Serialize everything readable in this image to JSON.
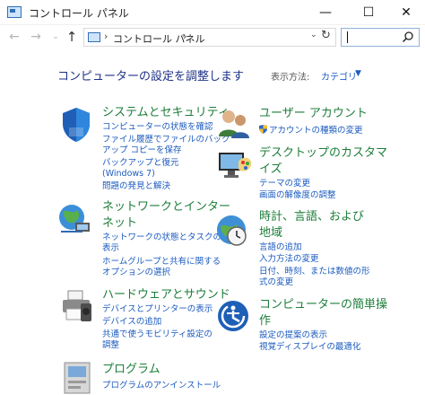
{
  "window": {
    "title": "コントロール パネル",
    "buttons": {
      "minimize": "—",
      "maximize": "☐",
      "close": "✕"
    }
  },
  "nav": {
    "back": "←",
    "forward": "→",
    "history": "⌄",
    "up": "↑",
    "breadcrumb_sep": "›",
    "breadcrumb": "コントロール パネル",
    "dropdown": "⌄",
    "refresh": "↻",
    "search_placeholder": ""
  },
  "content": {
    "heading": "コンピューターの設定を調整します",
    "view_label": "表示方法:",
    "view_value": "カテゴリ",
    "view_caret": "▼"
  },
  "categories": {
    "system": {
      "icon": "shield-icon",
      "title": "システムとセキュリティ",
      "links": [
        "コンピューターの状態を確認",
        "ファイル履歴でファイルのバック",
        "アップ コピーを保存",
        "バックアップと復元",
        "(Windows 7)",
        "問題の発見と解決"
      ]
    },
    "network": {
      "icon": "network-globe-icon",
      "title_lines": [
        "ネットワークとインター",
        "ネット"
      ],
      "links": [
        "ネットワークの状態とタスクの",
        "表示",
        "ホームグループと共有に関する",
        "オプションの選択"
      ]
    },
    "hardware": {
      "icon": "printer-icon",
      "title": "ハードウェアとサウンド",
      "links": [
        "デバイスとプリンターの表示",
        "デバイスの追加",
        "共通で使うモビリティ設定の",
        "調整"
      ]
    },
    "programs": {
      "icon": "programs-icon",
      "title": "プログラム",
      "links": [
        "プログラムのアンインストール"
      ]
    },
    "users": {
      "icon": "users-icon",
      "title": "ユーザー アカウント",
      "links": [
        "アカウントの種類の変更"
      ]
    },
    "appearance": {
      "icon": "display-palette-icon",
      "title_lines": [
        "デスクトップのカスタマ",
        "イズ"
      ],
      "links": [
        "テーマの変更",
        "画面の解像度の調整"
      ]
    },
    "clock": {
      "icon": "clock-globe-icon",
      "title_lines": [
        "時計、言語、および",
        "地域"
      ],
      "links": [
        "言語の追加",
        "入力方法の変更",
        "日付、時刻、または数値の形",
        "式の変更"
      ]
    },
    "ease": {
      "icon": "ease-of-access-icon",
      "title_lines": [
        "コンピューターの簡単操",
        "作"
      ],
      "links": [
        "設定の提案の表示",
        "視覚ディスプレイの最適化"
      ]
    }
  }
}
